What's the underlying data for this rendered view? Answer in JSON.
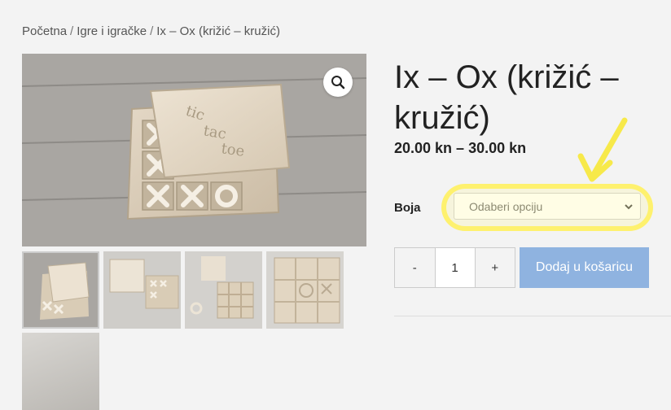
{
  "breadcrumb": {
    "items": [
      "Početna",
      "Igre i igračke",
      "Ix – Ox (križić – kružić)"
    ],
    "separator": "/"
  },
  "product": {
    "title": "Ix – Ox (križić – kružić)",
    "price": "20.00 kn – 30.00 kn",
    "attribute_label": "Boja",
    "select": {
      "selected": "Odaberi opciju",
      "options": [
        "Odaberi opciju"
      ]
    },
    "quantity": {
      "minus": "-",
      "value": "1",
      "plus": "+"
    },
    "add_to_cart_label": "Dodaj u košaricu",
    "lid_engraving": [
      "tic",
      "tac",
      "toe"
    ]
  },
  "gallery": {
    "zoom_icon": "magnifier-icon",
    "thumbnail_count": 5
  },
  "colors": {
    "background": "#f3f3f3",
    "button": "#8fb3e0",
    "annotation": "#f7e94a"
  }
}
